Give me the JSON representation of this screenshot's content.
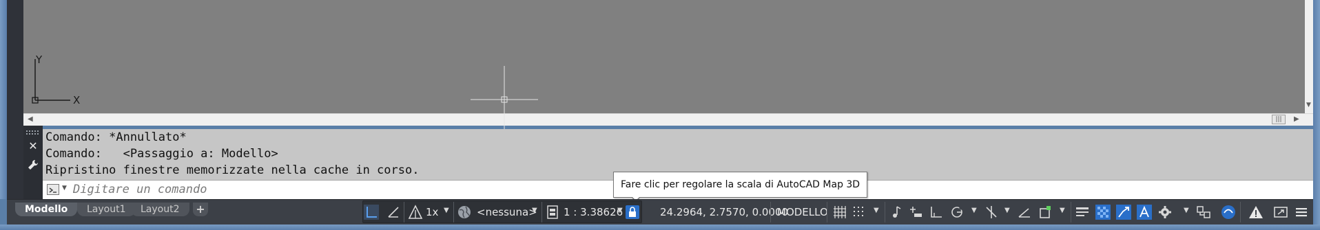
{
  "canvas": {
    "ucs_x_label": "X",
    "ucs_y_label": "Y",
    "background": "#808080"
  },
  "command_line": {
    "history": [
      "Comando: *Annullato*",
      "Comando:   <Passaggio a: Modello>",
      "Ripristino finestre memorizzate nella cache in corso."
    ],
    "input_placeholder": "Digitare un comando",
    "input_value": ""
  },
  "tooltip": {
    "text": "Fare clic per regolare la scala di AutoCAD Map 3D"
  },
  "layout_tabs": {
    "tabs": [
      "Modello",
      "Layout1",
      "Layout2"
    ],
    "active": "Modello",
    "add_label": "+"
  },
  "status_bar": {
    "annotation_scale": "1x",
    "workspace": "<nessuna>",
    "map_scale": "1 : 3.38626",
    "coordinates": "24.2964, 2.7570, 0.0000",
    "space": "MODELLO"
  },
  "colors": {
    "status_bar_bg": "#3c4047",
    "command_history_bg": "#c6c6c6",
    "accent_blue": "#3d8ee6"
  }
}
